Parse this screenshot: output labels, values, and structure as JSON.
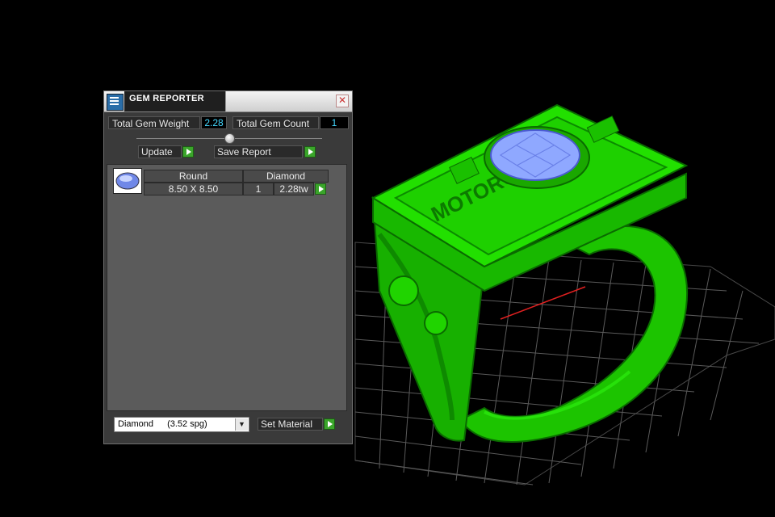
{
  "window": {
    "title": "GEM REPORTER",
    "close_glyph": "✕"
  },
  "totals": {
    "weight_label": "Total Gem Weight",
    "weight_value": "2.28",
    "count_label": "Total Gem Count",
    "count_value": "1"
  },
  "toolbar": {
    "update_label": "Update",
    "save_report_label": "Save Report"
  },
  "gems": [
    {
      "icon": "round-gem-icon",
      "shape": "Round",
      "material": "Diamond",
      "size": "8.50 X 8.50",
      "count": "1",
      "weight": "2.28tw"
    }
  ],
  "material_select": {
    "name": "Diamond",
    "density": "(3.52 spg)"
  },
  "set_material_label": "Set Material",
  "colors": {
    "ring_green": "#22e400",
    "gem_blue": "#8fa8ff",
    "value_cyan": "#44d8ff",
    "play_green": "#3aa52a"
  },
  "ring_text": "MOTORCYCLE"
}
